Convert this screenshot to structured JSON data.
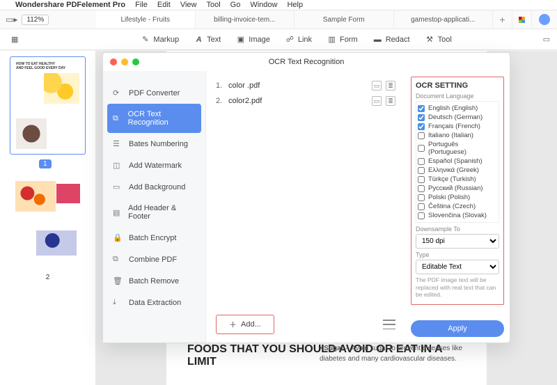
{
  "menubar": {
    "appname": "Wondershare PDFelement Pro",
    "items": [
      "File",
      "Edit",
      "View",
      "Tool",
      "Go",
      "Window",
      "Help"
    ]
  },
  "topbar": {
    "zoom": "112%",
    "tabs": [
      "Lifestyle - Fruits",
      "billing-invoice-tem...",
      "Sample Form",
      "gamestop-applicati..."
    ]
  },
  "toolbar": {
    "markup": "Markup",
    "text": "Text",
    "image": "Image",
    "link": "Link",
    "form": "Form",
    "redact": "Redact",
    "tool": "Tool"
  },
  "thumbs": {
    "page1": "1",
    "page2": "2"
  },
  "doc": {
    "heading": "FOODS THAT YOU SHOULD AVOID OR EAT IN A LIMIT",
    "bullet_label": "Sugar",
    "bullet_rest": " – Avoid sugar to prevent diseases like diabetes and many cardiovascular diseases."
  },
  "modal": {
    "title": "OCR Text Recognition",
    "side": {
      "pdf_converter": "PDF Converter",
      "ocr": "OCR Text Recognition",
      "bates": "Bates Numbering",
      "watermark": "Add Watermark",
      "background": "Add Background",
      "header_footer": "Add Header & Footer",
      "encrypt": "Batch Encrypt",
      "combine": "Combine PDF",
      "remove": "Batch Remove",
      "extract": "Data Extraction"
    },
    "files": [
      {
        "n": "1.",
        "name": "color .pdf"
      },
      {
        "n": "2.",
        "name": "color2.pdf"
      }
    ],
    "add": "Add...",
    "settings": {
      "heading": "OCR SETTING",
      "lang_label": "Document Language",
      "languages": [
        {
          "label": "English (English)",
          "checked": true
        },
        {
          "label": "Deutsch (German)",
          "checked": true
        },
        {
          "label": "Français (French)",
          "checked": true
        },
        {
          "label": "Italiano (Italian)",
          "checked": false
        },
        {
          "label": "Português (Portuguese)",
          "checked": false
        },
        {
          "label": "Español (Spanish)",
          "checked": false
        },
        {
          "label": "Ελληνικά (Greek)",
          "checked": false
        },
        {
          "label": "Türkçe (Turkish)",
          "checked": false
        },
        {
          "label": "Русский (Russian)",
          "checked": false
        },
        {
          "label": "Polski (Polish)",
          "checked": false
        },
        {
          "label": "Čeština (Czech)",
          "checked": false
        },
        {
          "label": "Slovenčina (Slovak)",
          "checked": false
        }
      ],
      "downsample_label": "Downsample To",
      "downsample_value": "150 dpi",
      "type_label": "Type",
      "type_value": "Editable Text",
      "note": "The PDF image text will be replaced with real text that can be edited.",
      "apply": "Apply"
    }
  }
}
